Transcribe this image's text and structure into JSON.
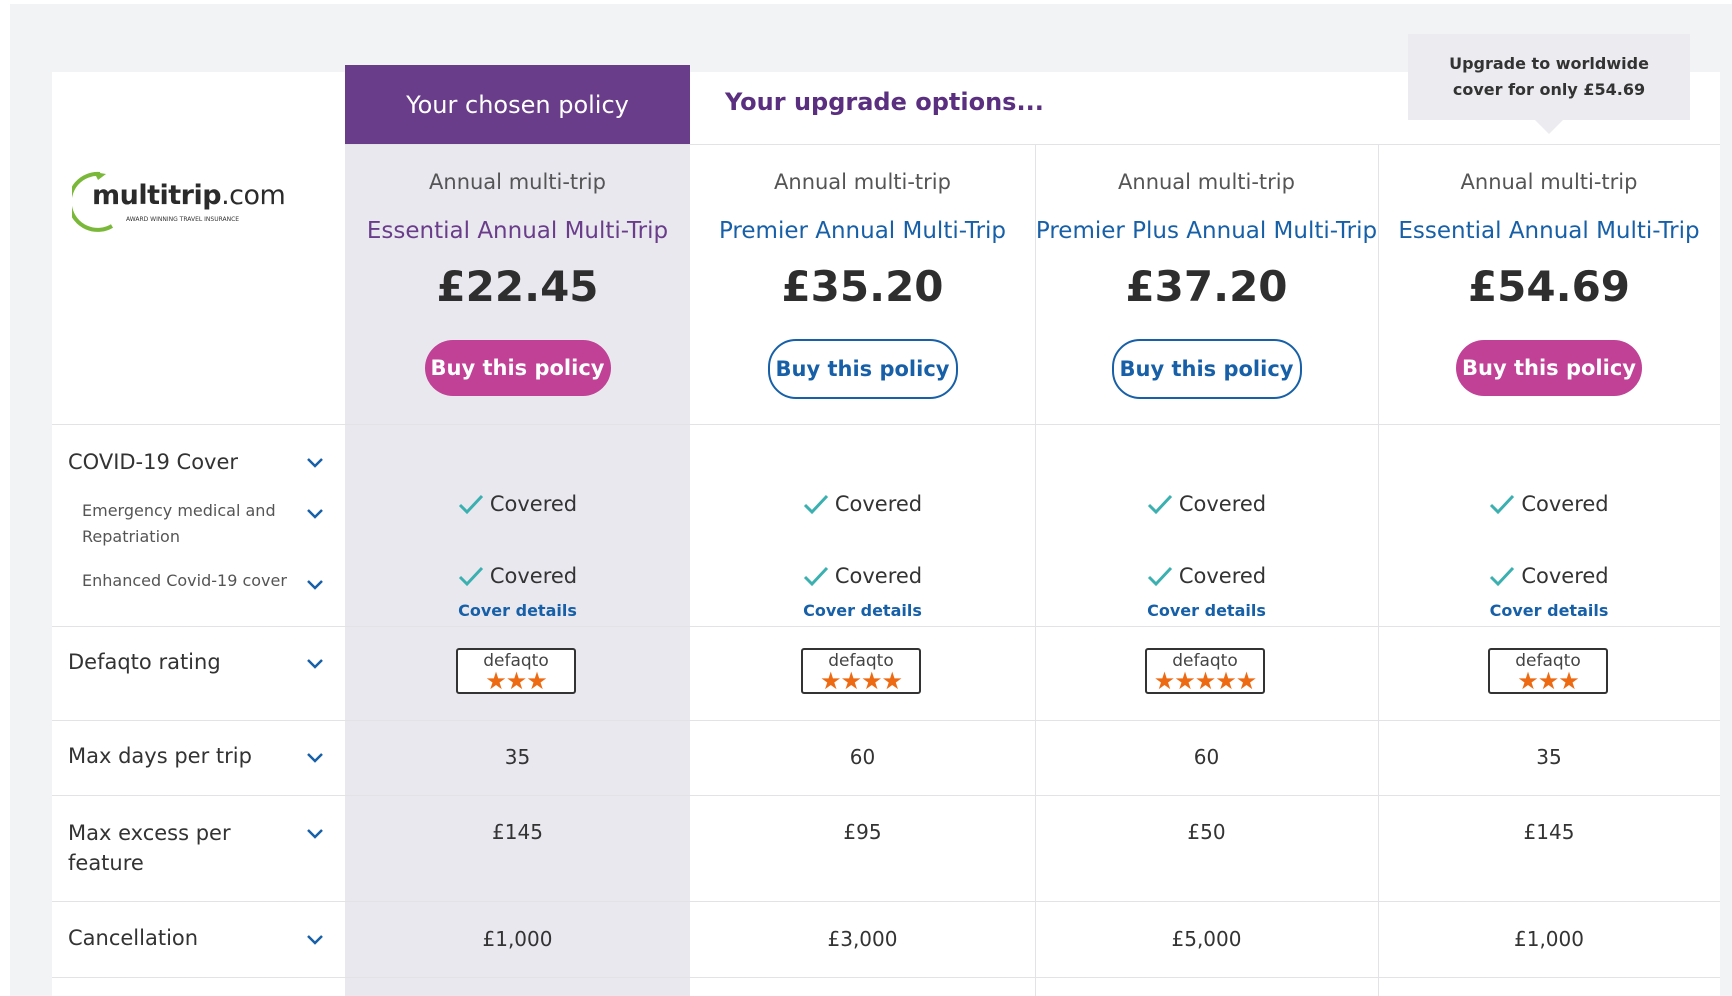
{
  "header": {
    "chosen_label": "Your chosen policy",
    "upgrade_label": "Your upgrade options...",
    "tooltip": "Upgrade to worldwide cover for only £54.69"
  },
  "logo": {
    "text_bold": "multitrip",
    "text_rest": ".com",
    "tagline": "AWARD WINNING TRAVEL INSURANCE"
  },
  "plans": [
    {
      "type": "Annual multi-trip",
      "name": "Essential Annual Multi-Trip",
      "price": "£22.45",
      "button": "Buy this policy",
      "covid_emergency": "Covered",
      "covid_enhanced": "Covered",
      "cover_details": "Cover details",
      "defaqto_word": "defaqto",
      "defaqto_stars": 3,
      "defaqto_stars_text": "★★★",
      "max_days": "35",
      "max_excess": "£145",
      "cancellation": "£1,000"
    },
    {
      "type": "Annual multi-trip",
      "name": "Premier Annual Multi-Trip",
      "price": "£35.20",
      "button": "Buy this policy",
      "covid_emergency": "Covered",
      "covid_enhanced": "Covered",
      "cover_details": "Cover details",
      "defaqto_word": "defaqto",
      "defaqto_stars": 4,
      "defaqto_stars_text": "★★★★",
      "max_days": "60",
      "max_excess": "£95",
      "cancellation": "£3,000"
    },
    {
      "type": "Annual multi-trip",
      "name": "Premier Plus Annual Multi-Trip",
      "price": "£37.20",
      "button": "Buy this policy",
      "covid_emergency": "Covered",
      "covid_enhanced": "Covered",
      "cover_details": "Cover details",
      "defaqto_word": "defaqto",
      "defaqto_stars": 5,
      "defaqto_stars_text": "★★★★★",
      "max_days": "60",
      "max_excess": "£50",
      "cancellation": "£5,000"
    },
    {
      "type": "Annual multi-trip",
      "name": "Essential Annual Multi-Trip",
      "price": "£54.69",
      "button": "Buy this policy",
      "covid_emergency": "Covered",
      "covid_enhanced": "Covered",
      "cover_details": "Cover details",
      "defaqto_word": "defaqto",
      "defaqto_stars": 3,
      "defaqto_stars_text": "★★★",
      "max_days": "35",
      "max_excess": "£145",
      "cancellation": "£1,000"
    }
  ],
  "rows": {
    "covid": "COVID-19 Cover",
    "covid_emergency": "Emergency medical and Repatriation",
    "covid_enhanced": "Enhanced Covid-19 cover",
    "defaqto": "Defaqto rating",
    "max_days": "Max days per trip",
    "max_excess": "Max excess per feature",
    "cancellation": "Cancellation"
  },
  "colors": {
    "chosen_header": "#6a3d8a",
    "buy_filled": "#c04196",
    "link_blue": "#1760a8",
    "check_teal": "#3bb0b0",
    "star_orange": "#ee6a12"
  }
}
